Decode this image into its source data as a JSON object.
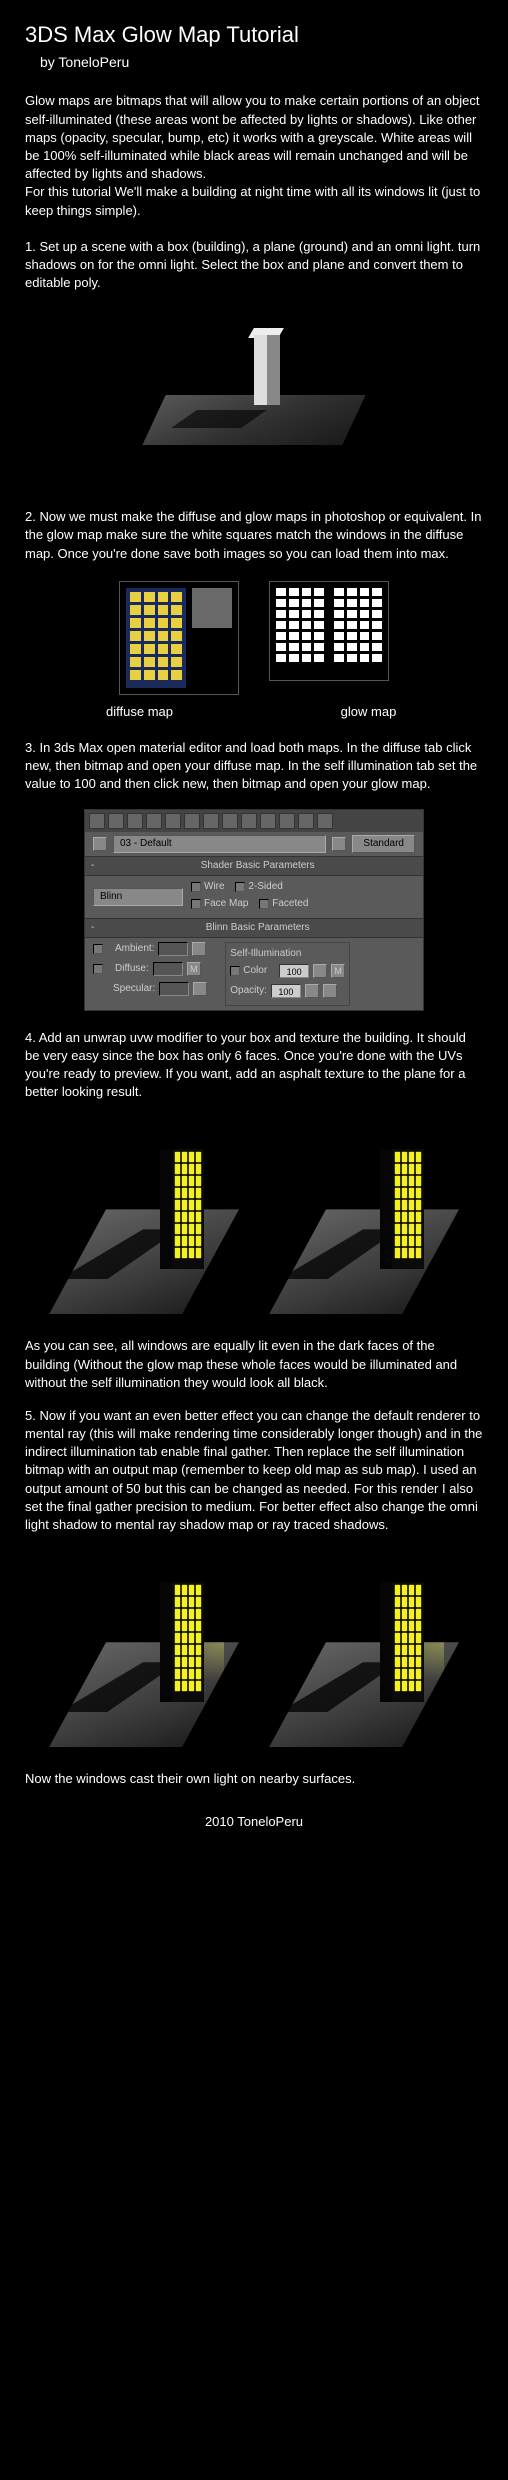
{
  "title": "3DS Max Glow Map Tutorial",
  "author": "by ToneloPeru",
  "intro": "Glow maps are bitmaps that will allow you to make certain portions of an object self-illuminated (these areas wont be affected by lights or shadows). Like other maps (opacity, specular, bump, etc) it works with a greyscale. White areas will be 100% self-illuminated while black areas will remain unchanged and will be affected by lights and shadows.\nFor this tutorial We'll make a building at night time with all its windows lit (just to keep things simple).",
  "step1": "1. Set up a scene with a box (building), a plane (ground) and an omni light. turn shadows on for the omni light. Select the box and plane and convert them to editable poly.",
  "step2": "2. Now we must make the diffuse and glow maps in photoshop or equivalent. In the glow map make sure the white squares match the windows in the diffuse map. Once you're done save both images so you can load them into max.",
  "maplabel_diffuse": "diffuse map",
  "maplabel_glow": "glow map",
  "step3": "3. In 3ds Max open material editor and load both maps. In the diffuse tab click new, then bitmap and open your diffuse map. In the self illumination tab set the value to 100 and then click new, then bitmap and open your glow map.",
  "mat": {
    "slot": "03 - Default",
    "type": "Standard",
    "sec_shader": "Shader Basic Parameters",
    "shader": "Blinn",
    "wire": "Wire",
    "twosided": "2-Sided",
    "facemap": "Face Map",
    "faceted": "Faceted",
    "sec_blinn": "Blinn Basic Parameters",
    "ambient": "Ambient:",
    "diffuse": "Diffuse:",
    "specular": "Specular:",
    "selfillum": "Self-Illumination",
    "color": "Color",
    "opacity": "Opacity:",
    "v100": "100",
    "m": "M"
  },
  "step4": "4. Add an unwrap uvw modifier to your box and texture the building. It should be very easy since the box has only 6 faces. Once you're done with the UVs you're ready to preview. If you want, add an asphalt texture to the plane for a better looking result.",
  "observation": "As you can see, all windows are equally lit even in the dark faces of the building (Without the glow map these whole faces would be illuminated and without the self illumination they would look all black.",
  "step5": "5. Now if you want an even better effect you can change the default renderer to mental ray (this will make rendering time considerably longer though) and in the indirect illumination tab enable final gather. Then replace the self illumination bitmap with an output map (remember to keep old map as sub map). I used an output amount of 50 but this can be changed as needed. For this render I also set the final gather precision to medium. For better effect also change the omni light shadow to mental ray shadow map or ray traced shadows.",
  "closing": "Now the windows cast their own light on nearby surfaces.",
  "footer": "2010 ToneloPeru"
}
